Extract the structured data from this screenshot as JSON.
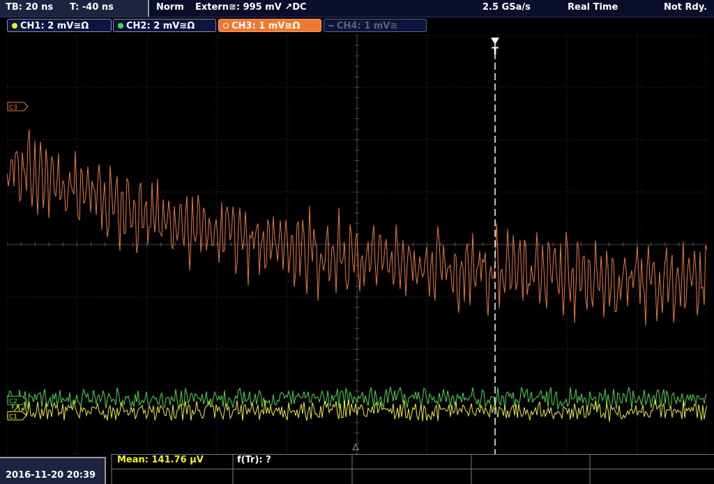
{
  "topbar": {
    "timebase": "TB: 20 ns",
    "trigger_time": "T: -40 ns",
    "mode": "Norm",
    "trigger_source": "Extern≅: 995 mV ↗DC",
    "sample_rate": "2.5 GSa/s",
    "acquisition": "Real Time",
    "status": "Not Rdy."
  },
  "channels": [
    {
      "label": "CH1: 2 mV≅Ω",
      "color": "#f4f020",
      "state": "on"
    },
    {
      "label": "CH2: 2 mV≅Ω",
      "color": "#40e040",
      "state": "on"
    },
    {
      "label": "CH3: 1 mV≅Ω",
      "color": "#f07830",
      "state": "active"
    },
    {
      "label": "CH4: 1 mV≅",
      "color": "#5e6478",
      "state": "off"
    }
  ],
  "markers": {
    "ch3": "C3",
    "ch2": "C2",
    "ch1": "C1",
    "trigger": "T"
  },
  "measurements": {
    "mean": "Mean: 141.76 µV",
    "rise": "f(Tr): ?"
  },
  "datetime": "2016-11-20 20:39",
  "colors": {
    "ch1": "#f4f020",
    "ch2": "#40e040",
    "ch3": "#f07830",
    "grid": "#3a3a3a"
  }
}
